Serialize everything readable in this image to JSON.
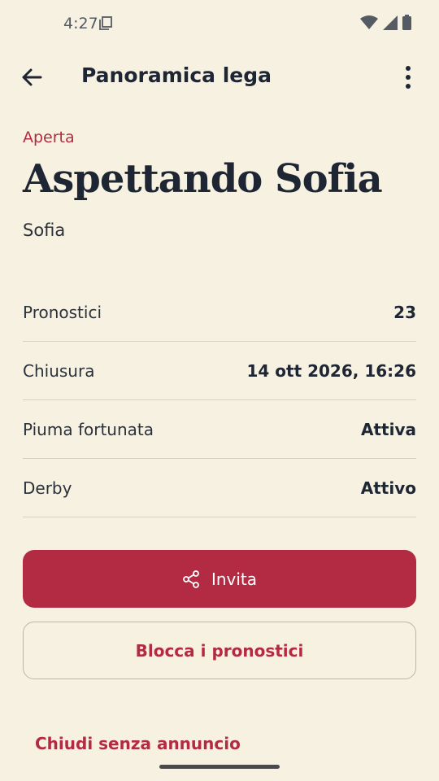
{
  "status_bar": {
    "time": "4:27",
    "icons": [
      "sim-card-icon",
      "wifi-icon",
      "signal-icon",
      "battery-icon"
    ]
  },
  "app_bar": {
    "title": "Panoramica lega",
    "back_icon": "arrow-left-icon",
    "menu_icon": "more-vertical-icon"
  },
  "league": {
    "status": "Aperta",
    "title": "Aspettando Sofia",
    "subtitle": "Sofia"
  },
  "details": [
    {
      "label": "Pronostici",
      "value": "23"
    },
    {
      "label": "Chiusura",
      "value": "14 ott 2026, 16:26"
    },
    {
      "label": "Piuma fortunata",
      "value": "Attiva"
    },
    {
      "label": "Derby",
      "value": "Attivo"
    }
  ],
  "actions": {
    "invite_label": "Invita",
    "invite_icon": "share-icon",
    "lock_label": "Blocca i pronostici",
    "close_label": "Chiudi senza annuncio"
  },
  "colors": {
    "background": "#f7f1e1",
    "accent": "#b32b42",
    "text": "#1f2633"
  }
}
